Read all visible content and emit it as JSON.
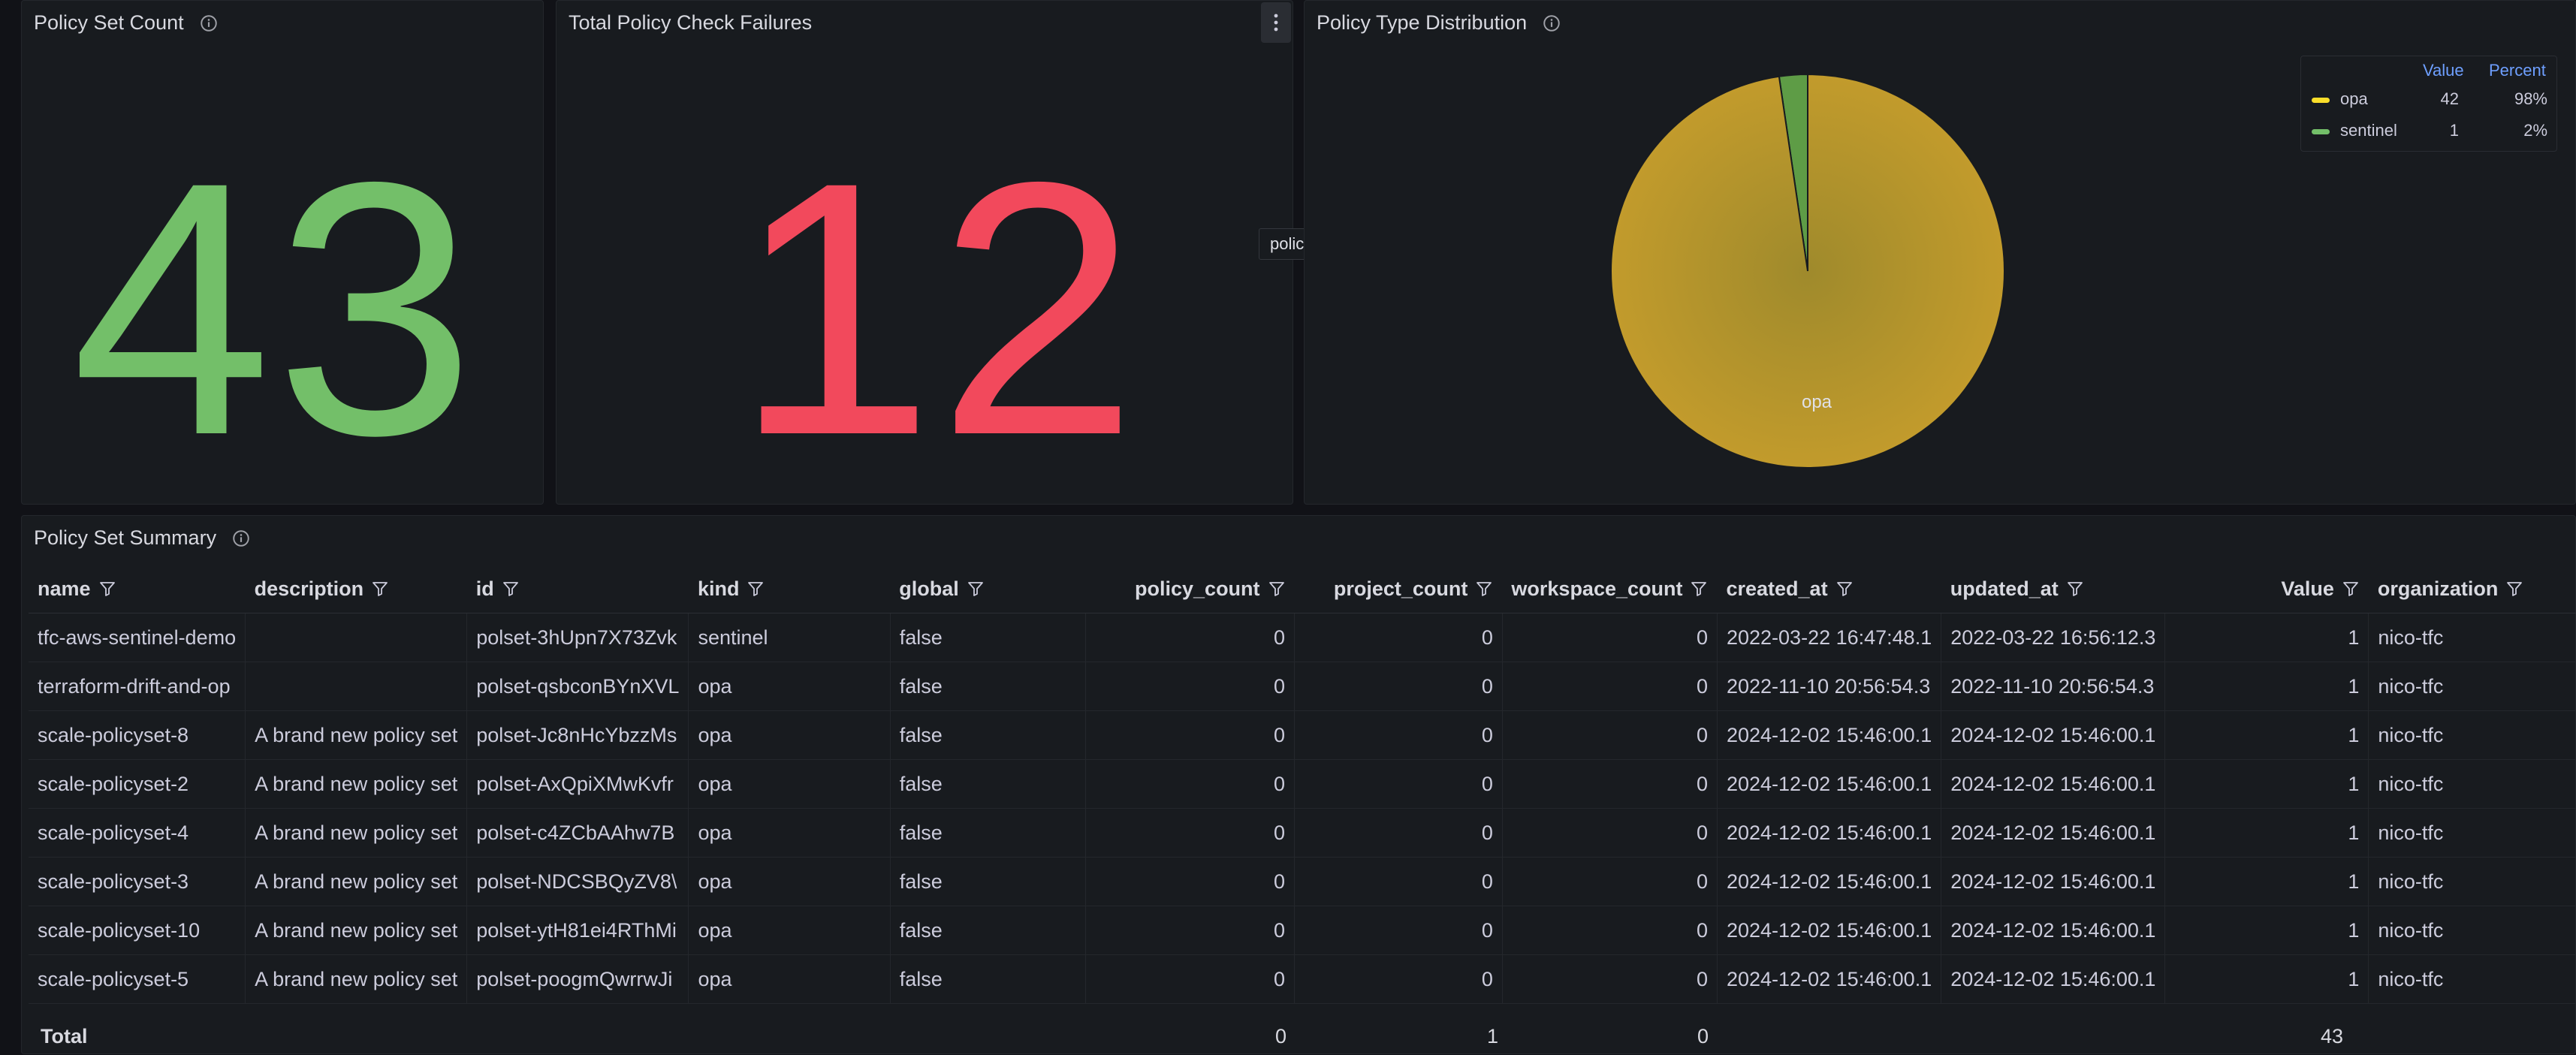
{
  "panels": {
    "policy_set_count": {
      "title": "Policy Set Count",
      "value": "43",
      "color": "#73bf69"
    },
    "total_failures": {
      "title": "Total Policy Check Failures",
      "value": "12",
      "color": "#f2495c",
      "tooltip": "policy_check_failures"
    },
    "type_distribution": {
      "title": "Policy Type Distribution",
      "slice_label": "opa",
      "legend": {
        "value_header": "Value",
        "percent_header": "Percent",
        "items": [
          {
            "name": "opa",
            "value": "42",
            "percent": "98%",
            "color": "#fade2a"
          },
          {
            "name": "sentinel",
            "value": "1",
            "percent": "2%",
            "color": "#73bf69"
          }
        ]
      }
    }
  },
  "chart_data": {
    "type": "pie",
    "title": "Policy Type Distribution",
    "categories": [
      "opa",
      "sentinel"
    ],
    "values": [
      42,
      1
    ],
    "colors": [
      "#c19a2b",
      "#5e9c46"
    ]
  },
  "summary": {
    "title": "Policy Set Summary",
    "columns": [
      "name",
      "description",
      "id",
      "kind",
      "global",
      "policy_count",
      "project_count",
      "workspace_count",
      "created_at",
      "updated_at",
      "Value",
      "organization"
    ],
    "rows": [
      [
        "tfc-aws-sentinel-demo",
        "",
        "polset-3hUpn7X73Zvk",
        "sentinel",
        "false",
        "0",
        "0",
        "0",
        "2022-03-22 16:47:48.1",
        "2022-03-22 16:56:12.3",
        "1",
        "nico-tfc"
      ],
      [
        "terraform-drift-and-op",
        "",
        "polset-qsbconBYnXVL",
        "opa",
        "false",
        "0",
        "0",
        "0",
        "2022-11-10 20:56:54.3",
        "2022-11-10 20:56:54.3",
        "1",
        "nico-tfc"
      ],
      [
        "scale-policyset-8",
        "A brand new policy set",
        "polset-Jc8nHcYbzzMs",
        "opa",
        "false",
        "0",
        "0",
        "0",
        "2024-12-02 15:46:00.1",
        "2024-12-02 15:46:00.1",
        "1",
        "nico-tfc"
      ],
      [
        "scale-policyset-2",
        "A brand new policy set",
        "polset-AxQpiXMwKvfr",
        "opa",
        "false",
        "0",
        "0",
        "0",
        "2024-12-02 15:46:00.1",
        "2024-12-02 15:46:00.1",
        "1",
        "nico-tfc"
      ],
      [
        "scale-policyset-4",
        "A brand new policy set",
        "polset-c4ZCbAAhw7B",
        "opa",
        "false",
        "0",
        "0",
        "0",
        "2024-12-02 15:46:00.1",
        "2024-12-02 15:46:00.1",
        "1",
        "nico-tfc"
      ],
      [
        "scale-policyset-3",
        "A brand new policy set",
        "polset-NDCSBQyZV8\\",
        "opa",
        "false",
        "0",
        "0",
        "0",
        "2024-12-02 15:46:00.1",
        "2024-12-02 15:46:00.1",
        "1",
        "nico-tfc"
      ],
      [
        "scale-policyset-10",
        "A brand new policy set",
        "polset-ytH81ei4RThMi",
        "opa",
        "false",
        "0",
        "0",
        "0",
        "2024-12-02 15:46:00.1",
        "2024-12-02 15:46:00.1",
        "1",
        "nico-tfc"
      ],
      [
        "scale-policyset-5",
        "A brand new policy set",
        "polset-poogmQwrrwJi",
        "opa",
        "false",
        "0",
        "0",
        "0",
        "2024-12-02 15:46:00.1",
        "2024-12-02 15:46:00.1",
        "1",
        "nico-tfc"
      ]
    ],
    "totals": {
      "label": "Total",
      "policy_count": "0",
      "project_count": "1",
      "workspace_count": "0",
      "value": "43"
    }
  }
}
